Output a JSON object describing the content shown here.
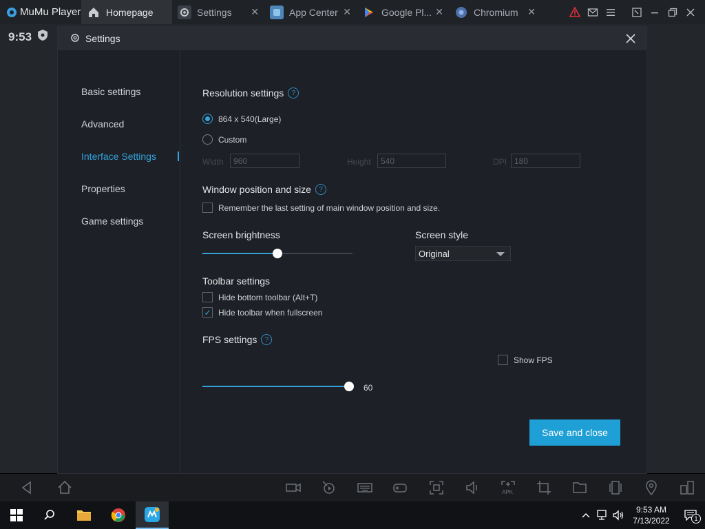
{
  "titlebar": {
    "app_name": "MuMu Player",
    "tabs": [
      {
        "label": "Homepage",
        "icon": "home-icon",
        "active": true
      },
      {
        "label": "Settings",
        "icon": "gear-icon",
        "active": false
      },
      {
        "label": "App Center",
        "icon": "app-center-icon",
        "active": false
      },
      {
        "label": "Google Pl...",
        "icon": "google-play-icon",
        "active": false
      },
      {
        "label": "Chromium",
        "icon": "chromium-icon",
        "active": false
      }
    ]
  },
  "android": {
    "time": "9:53"
  },
  "dialog": {
    "title": "Settings",
    "nav": [
      {
        "label": "Basic settings"
      },
      {
        "label": "Advanced"
      },
      {
        "label": "Interface Settings"
      },
      {
        "label": "Properties"
      },
      {
        "label": "Game settings"
      }
    ],
    "resolution": {
      "title": "Resolution settings",
      "option_large": "864 x 540(Large)",
      "option_custom": "Custom",
      "width_label": "Width",
      "width_value": "960",
      "height_label": "Height",
      "height_value": "540",
      "dpi_label": "DPI",
      "dpi_value": "180"
    },
    "window_position": {
      "title": "Window position and size",
      "remember_label": "Remember the last setting of main window position and size."
    },
    "brightness": {
      "title": "Screen brightness",
      "level": 0.5
    },
    "screen_style": {
      "title": "Screen style",
      "selected": "Original"
    },
    "toolbar": {
      "title": "Toolbar settings",
      "hide_bottom": "Hide bottom toolbar (Alt+T)",
      "hide_fullscreen": "Hide toolbar when fullscreen"
    },
    "fps": {
      "title": "FPS settings",
      "value": "60",
      "level": 1.0,
      "show_fps": "Show FPS"
    },
    "save_button": "Save and close"
  },
  "taskbar": {
    "time": "9:53 AM",
    "date": "7/13/2022",
    "notification_count": "1"
  },
  "colors": {
    "accent": "#33a3dc",
    "button": "#1e9fd6"
  }
}
